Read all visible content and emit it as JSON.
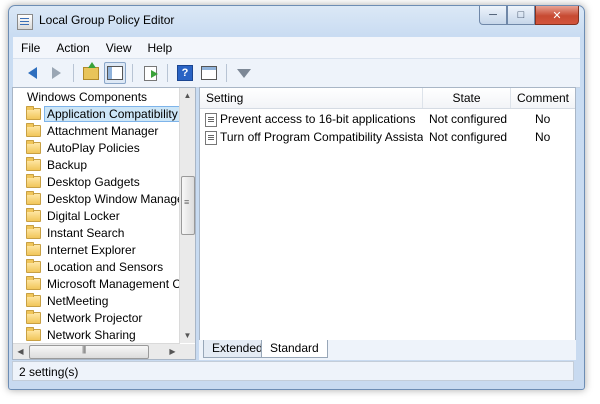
{
  "window": {
    "title": "Local Group Policy Editor"
  },
  "window_controls": {
    "minimize": "─",
    "maximize": "□",
    "close": "✕"
  },
  "menu": [
    "File",
    "Action",
    "View",
    "Help"
  ],
  "toolbar": {
    "icons": [
      "back-icon",
      "forward-icon",
      "up-folder-icon",
      "show-hide-tree-icon",
      "export-list-icon",
      "help-icon",
      "properties-icon",
      "filter-icon"
    ]
  },
  "tree": {
    "root": "Windows Components",
    "items": [
      "Application Compatibility",
      "Attachment Manager",
      "AutoPlay Policies",
      "Backup",
      "Desktop Gadgets",
      "Desktop Window Manager",
      "Digital Locker",
      "Instant Search",
      "Internet Explorer",
      "Location and Sensors",
      "Microsoft Management Co",
      "NetMeeting",
      "Network Projector",
      "Network Sharing"
    ],
    "selected_index": 0
  },
  "list": {
    "columns": {
      "setting": "Setting",
      "state": "State",
      "comment": "Comment"
    },
    "rows": [
      {
        "setting": "Prevent access to 16-bit applications",
        "state": "Not configured",
        "comment": "No"
      },
      {
        "setting": "Turn off Program Compatibility Assistant",
        "state": "Not configured",
        "comment": "No"
      }
    ]
  },
  "tabs": {
    "extended": "Extended",
    "standard": "Standard",
    "active": "Standard"
  },
  "status": {
    "text": "2 setting(s)"
  },
  "colors": {
    "selection": "#cde6f7",
    "title_bar": "#c9dcf2",
    "close_button": "#c74a32"
  }
}
